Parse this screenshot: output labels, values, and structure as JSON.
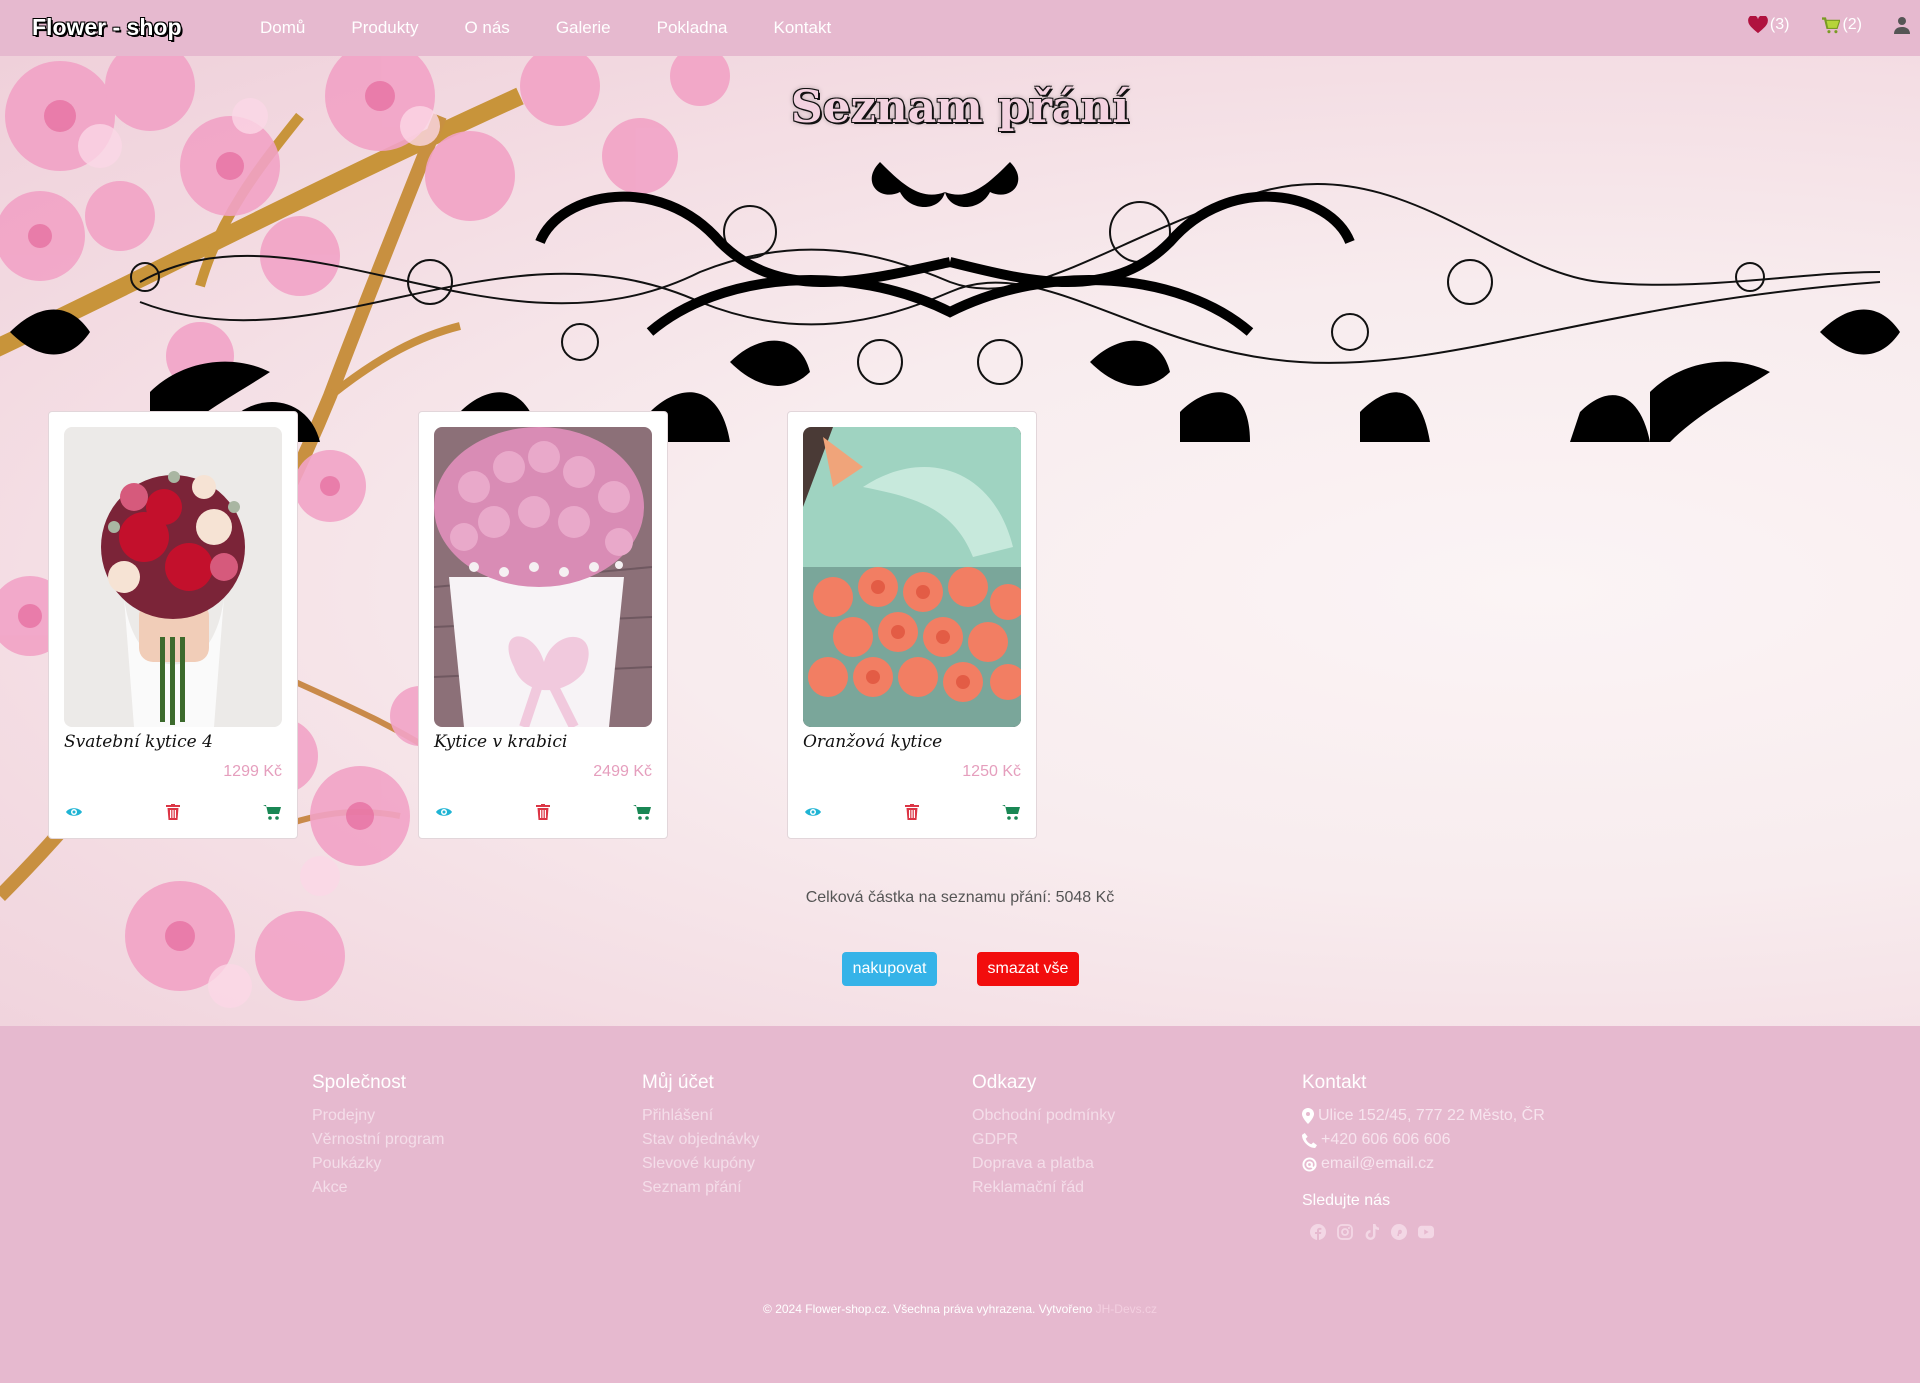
{
  "navbar": {
    "brand": "Flower - shop",
    "links": [
      "Domů",
      "Produkty",
      "O nás",
      "Galerie",
      "Pokladna",
      "Kontakt"
    ],
    "wishlist_count": "(3)",
    "cart_count": "(2)"
  },
  "page": {
    "title": "Seznam přání"
  },
  "products": [
    {
      "name": "Svatební kytice 4",
      "price": "1299 Kč"
    },
    {
      "name": "Kytice v krabici",
      "price": "2499 Kč"
    },
    {
      "name": "Oranžová kytice",
      "price": "1250 Kč"
    }
  ],
  "summary": {
    "total_text": "Celková částka na seznamu přání: 5048 Kč",
    "shop_button": "nakupovat",
    "clear_button": "smazat vše"
  },
  "footer": {
    "company": {
      "title": "Společnost",
      "items": [
        "Prodejny",
        "Věrnostní program",
        "Poukázky",
        "Akce"
      ]
    },
    "account": {
      "title": "Můj účet",
      "items": [
        "Přihlášení",
        "Stav objednávky",
        "Slevové kupóny",
        "Seznam přání"
      ]
    },
    "links": {
      "title": "Odkazy",
      "items": [
        "Obchodní podmínky",
        "GDPR",
        "Doprava a platba",
        "Reklamační řád"
      ]
    },
    "contact": {
      "title": "Kontakt",
      "address": "Ulice 152/45, 777 22 Město, ČR",
      "phone": "+420 606 606 606",
      "email": "email@email.cz",
      "follow": "Sledujte nás"
    },
    "copyright": "© 2024 Flower-shop.cz. Všechna práva vyhrazena. Vytvořeno",
    "developer": "JH-Devs.cz"
  },
  "colors": {
    "nav_bg": "#e6b9cf",
    "price": "#e59ebd",
    "eye": "#1fb4d4",
    "trash": "#dc3545",
    "cart": "#198754",
    "shop_button": "#35b3e8",
    "clear_button": "#f20d0d"
  },
  "icons": [
    "heart-icon",
    "cart-icon",
    "user-icon",
    "eye-icon",
    "trash-icon",
    "cart-add-icon",
    "map-marker-icon",
    "phone-icon",
    "at-icon",
    "facebook-icon",
    "instagram-icon",
    "tiktok-icon",
    "pinterest-icon",
    "youtube-icon"
  ]
}
